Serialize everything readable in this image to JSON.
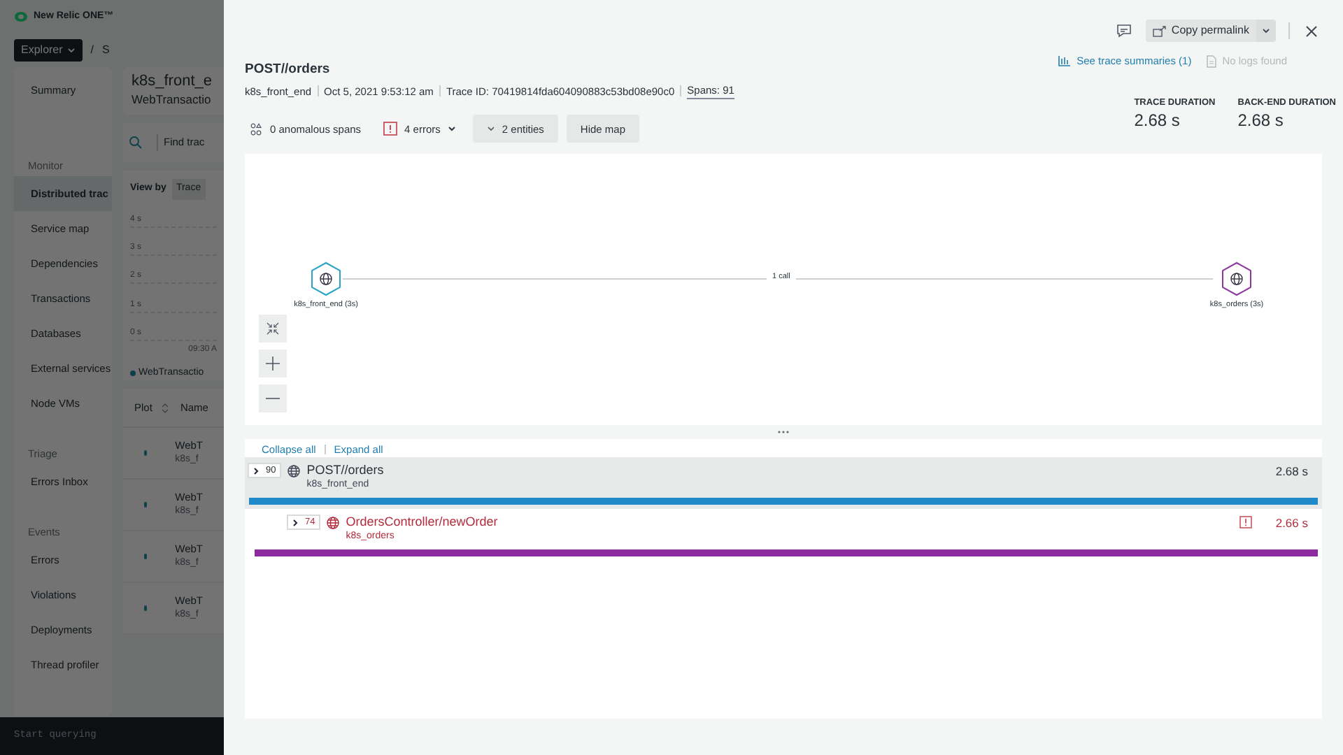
{
  "app_header": {
    "logo_text": "New Relic ONE™",
    "breadcrumb": {
      "explorer": "Explorer",
      "separator": "/",
      "next": "S"
    }
  },
  "sidebar": {
    "items": [
      {
        "kind": "item",
        "label": "Summary",
        "selected": false
      },
      {
        "kind": "section",
        "label": "Monitor"
      },
      {
        "kind": "item",
        "label": "Distributed trac",
        "selected": true
      },
      {
        "kind": "item",
        "label": "Service map",
        "selected": false
      },
      {
        "kind": "item",
        "label": "Dependencies",
        "selected": false
      },
      {
        "kind": "item",
        "label": "Transactions",
        "selected": false
      },
      {
        "kind": "item",
        "label": "Databases",
        "selected": false
      },
      {
        "kind": "item",
        "label": "External services",
        "selected": false
      },
      {
        "kind": "item",
        "label": "Node VMs",
        "selected": false
      },
      {
        "kind": "section",
        "label": "Triage"
      },
      {
        "kind": "item",
        "label": "Errors Inbox",
        "selected": false
      },
      {
        "kind": "section",
        "label": "Events"
      },
      {
        "kind": "item",
        "label": "Errors",
        "selected": false
      },
      {
        "kind": "item",
        "label": "Violations",
        "selected": false
      },
      {
        "kind": "item",
        "label": "Deployments",
        "selected": false
      },
      {
        "kind": "item",
        "label": "Thread profiler",
        "selected": false
      }
    ]
  },
  "query_bar": {
    "placeholder": "Start querying"
  },
  "background_page": {
    "title": "k8s_front_e",
    "subtitle": "WebTransactio",
    "search_placeholder": "Find trac",
    "view_by": {
      "label": "View by",
      "value": "Trace"
    },
    "chart_ticks": [
      "4 s",
      "3 s",
      "2 s",
      "1 s",
      "0 s"
    ],
    "time_label": "09:30 A",
    "legend": "WebTransactio",
    "table": {
      "columns": [
        "Plot",
        "Name"
      ],
      "rows": [
        {
          "name": "WebT",
          "entity": "k8s_f"
        },
        {
          "name": "WebT",
          "entity": "k8s_f"
        },
        {
          "name": "WebT",
          "entity": "k8s_f"
        },
        {
          "name": "WebT",
          "entity": "k8s_f"
        }
      ]
    }
  },
  "drawer": {
    "copy_permalink": "Copy permalink",
    "title": "POST//orders",
    "meta": [
      {
        "kind": "text",
        "text": "k8s_front_end"
      },
      {
        "kind": "text",
        "text": "Oct 5, 2021 9:53:12 am"
      },
      {
        "kind": "text",
        "text": "Trace ID: 70419814fda604090883c53bd08e90c0"
      },
      {
        "kind": "link",
        "text": "Spans: 91"
      }
    ],
    "links": [
      {
        "label": "See trace summaries (1)",
        "disabled": false
      },
      {
        "label": "No logs found",
        "disabled": true
      }
    ],
    "actions": [
      {
        "kind": "anomalous",
        "label": "0 anomalous spans"
      },
      {
        "kind": "errors",
        "label": "4 errors"
      },
      {
        "kind": "entities",
        "label": "2 entities"
      },
      {
        "kind": "plain",
        "label": "Hide map"
      }
    ],
    "stats": [
      {
        "label": "TRACE DURATION",
        "value": "2.68 s"
      },
      {
        "label": "BACK-END DURATION",
        "value": "2.68 s"
      }
    ],
    "map": {
      "nodes": [
        {
          "label": "k8s_front_end (3s)",
          "color": "#2aa3c5"
        },
        {
          "label": "k8s_orders (3s)",
          "color": "#8e3a9d"
        }
      ],
      "edge_label": "1 call"
    },
    "trace": {
      "collapse_all": "Collapse all",
      "expand_all": "Expand all",
      "spans": [
        {
          "count": "90",
          "name": "POST//orders",
          "entity": "k8s_front_end",
          "duration": "2.68 s",
          "error": false,
          "selected": true,
          "color": "#1e8ac7",
          "level": 1,
          "children": [
            {
              "count": "74",
              "name": "OrdersController/newOrder",
              "entity": "k8s_orders",
              "duration": "2.66 s",
              "error": true,
              "selected": false,
              "color": "#8e2aa0",
              "level": 1
            }
          ]
        }
      ]
    }
  }
}
